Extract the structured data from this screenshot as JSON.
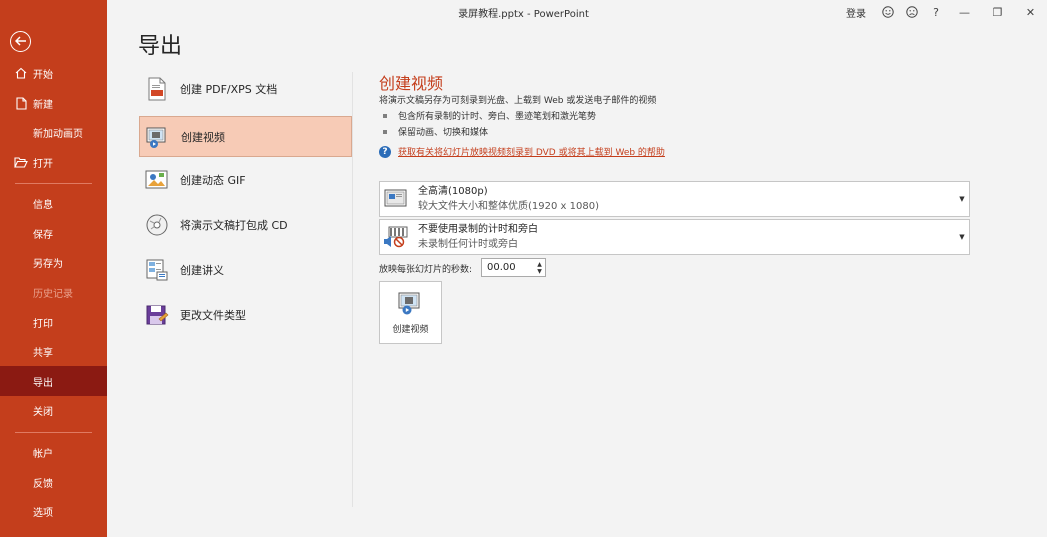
{
  "window": {
    "title": "录屏教程.pptx  -  PowerPoint",
    "login": "登录",
    "help": "?",
    "minimize": "—",
    "restore": "❐",
    "close": "✕"
  },
  "sidebar": {
    "back_icon": "back-arrow-icon",
    "items": [
      {
        "label": "开始",
        "icon": "home-icon"
      },
      {
        "label": "新建",
        "icon": "new-file-icon"
      },
      {
        "label": "新加动画页"
      },
      {
        "label": "打开",
        "icon": "folder-open-icon"
      },
      {
        "label": "信息"
      },
      {
        "label": "保存"
      },
      {
        "label": "另存为"
      },
      {
        "label": "历史记录",
        "disabled": true
      },
      {
        "label": "打印"
      },
      {
        "label": "共享"
      },
      {
        "label": "导出",
        "active": true
      },
      {
        "label": "关闭"
      },
      {
        "label": "帐户"
      },
      {
        "label": "反馈"
      },
      {
        "label": "选项"
      }
    ]
  },
  "page": {
    "title": "导出"
  },
  "export_options": [
    {
      "label": "创建 PDF/XPS 文档",
      "icon": "pdf-document-icon"
    },
    {
      "label": "创建视频",
      "icon": "video-icon",
      "selected": true
    },
    {
      "label": "创建动态 GIF",
      "icon": "gif-image-icon"
    },
    {
      "label": "将演示文稿打包成 CD",
      "icon": "cd-icon"
    },
    {
      "label": "创建讲义",
      "icon": "handout-icon"
    },
    {
      "label": "更改文件类型",
      "icon": "change-file-type-icon"
    }
  ],
  "detail": {
    "title": "创建视频",
    "description": "将演示文稿另存为可刻录到光盘、上载到 Web 或发送电子邮件的视频",
    "bullets": [
      "包含所有录制的计时、旁白、墨迹笔划和激光笔势",
      "保留动画、切换和媒体"
    ],
    "help_link": "获取有关将幻灯片放映视频刻录到 DVD 或将其上载到 Web 的帮助",
    "quality": {
      "main": "全高清(1080p)",
      "sub": "较大文件大小和整体优质(1920 x 1080)"
    },
    "timings": {
      "main": "不要使用录制的计时和旁白",
      "sub": "未录制任何计时或旁白"
    },
    "seconds_label": "放映每张幻灯片的秒数:",
    "seconds_value": "00.00",
    "create_button": "创建视频"
  },
  "colors": {
    "accent": "#c43e1c",
    "sidebar_active": "#8b1a12",
    "selected_bg": "#f7cbb6"
  }
}
